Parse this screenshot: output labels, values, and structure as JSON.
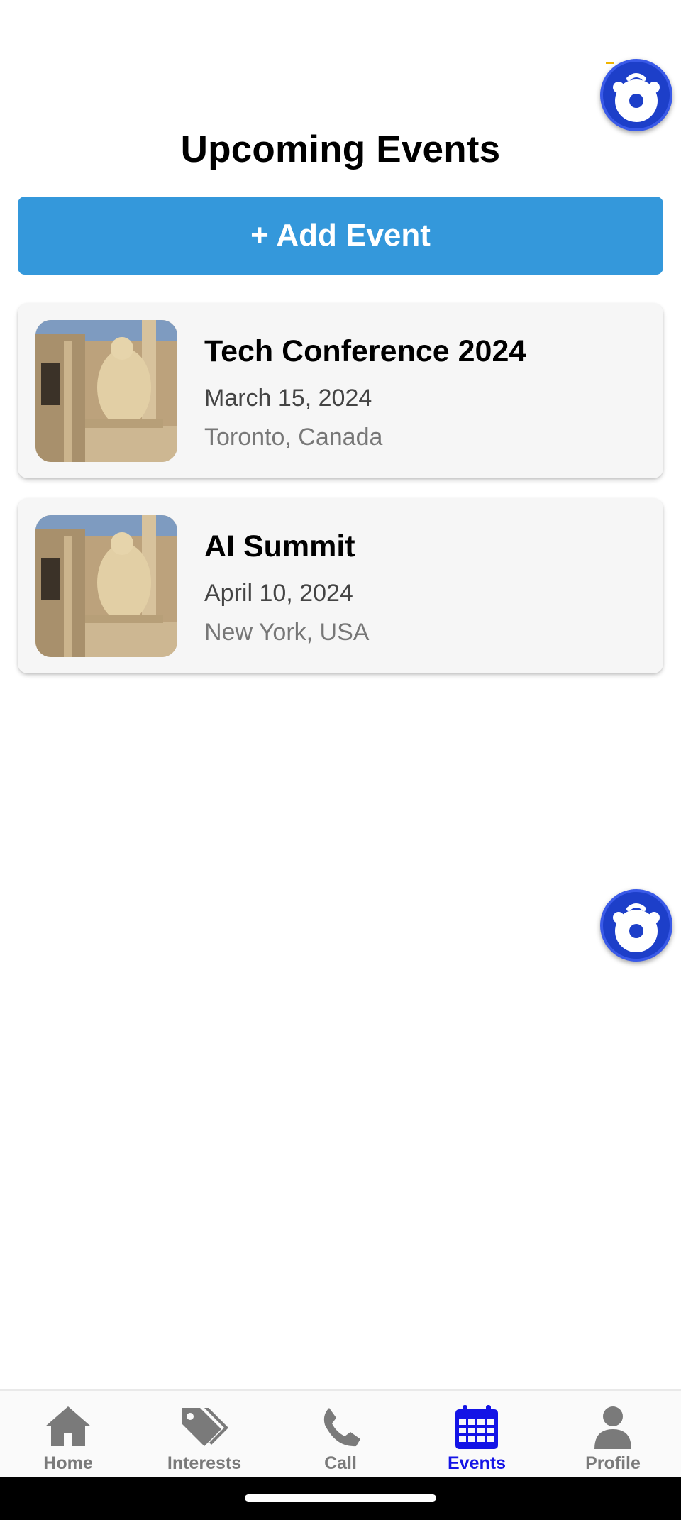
{
  "page": {
    "title": "Upcoming Events"
  },
  "actions": {
    "add_event_label": "+ Add Event"
  },
  "events": [
    {
      "title": "Tech Conference 2024",
      "date": "March 15, 2024",
      "location": "Toronto, Canada"
    },
    {
      "title": "AI Summit",
      "date": "April 10, 2024",
      "location": "New York, USA"
    }
  ],
  "nav": {
    "items": [
      {
        "label": "Home",
        "icon": "home-icon"
      },
      {
        "label": "Interests",
        "icon": "tags-icon"
      },
      {
        "label": "Call",
        "icon": "phone-icon"
      },
      {
        "label": "Events",
        "icon": "calendar-icon",
        "active": true
      },
      {
        "label": "Profile",
        "icon": "user-icon"
      }
    ]
  },
  "colors": {
    "primary": "#3498db",
    "active_nav": "#1414e6",
    "inactive_nav": "#7a7a7a",
    "fab": "#1d3fc9",
    "card_bg": "#f6f6f6"
  }
}
